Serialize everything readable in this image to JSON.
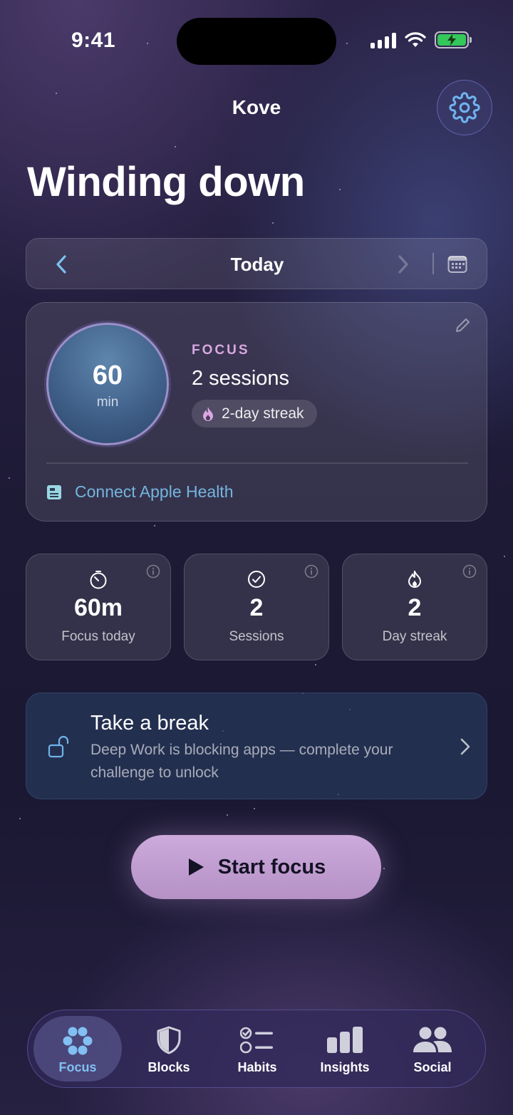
{
  "status_bar": {
    "time": "9:41"
  },
  "header": {
    "app_name": "Kove",
    "heading": "Winding down"
  },
  "date_nav": {
    "label": "Today"
  },
  "focus_card": {
    "ring_value": "60",
    "ring_unit": "min",
    "label": "FOCUS",
    "sessions": "2 sessions",
    "streak": "2-day streak",
    "health_link": "Connect Apple Health"
  },
  "stats": [
    {
      "value": "60m",
      "label": "Focus today",
      "icon": "timer-icon"
    },
    {
      "value": "2",
      "label": "Sessions",
      "icon": "check-circle-icon"
    },
    {
      "value": "2",
      "label": "Day streak",
      "icon": "flame-icon"
    }
  ],
  "break_card": {
    "title": "Take a break",
    "description": "Deep Work is blocking apps — complete your challenge to unlock"
  },
  "start_button": {
    "label": "Start focus"
  },
  "tabs": [
    {
      "label": "Focus",
      "icon": "dots-flower-icon",
      "active": true
    },
    {
      "label": "Blocks",
      "icon": "shield-icon",
      "active": false
    },
    {
      "label": "Habits",
      "icon": "checklist-icon",
      "active": false
    },
    {
      "label": "Insights",
      "icon": "bar-chart-icon",
      "active": false
    },
    {
      "label": "Social",
      "icon": "people-icon",
      "active": false
    }
  ],
  "colors": {
    "accent_blue": "#82bff2",
    "focus_label": "#d7a8e0",
    "link": "#74b5de",
    "start_button": "#c4a0d4"
  }
}
